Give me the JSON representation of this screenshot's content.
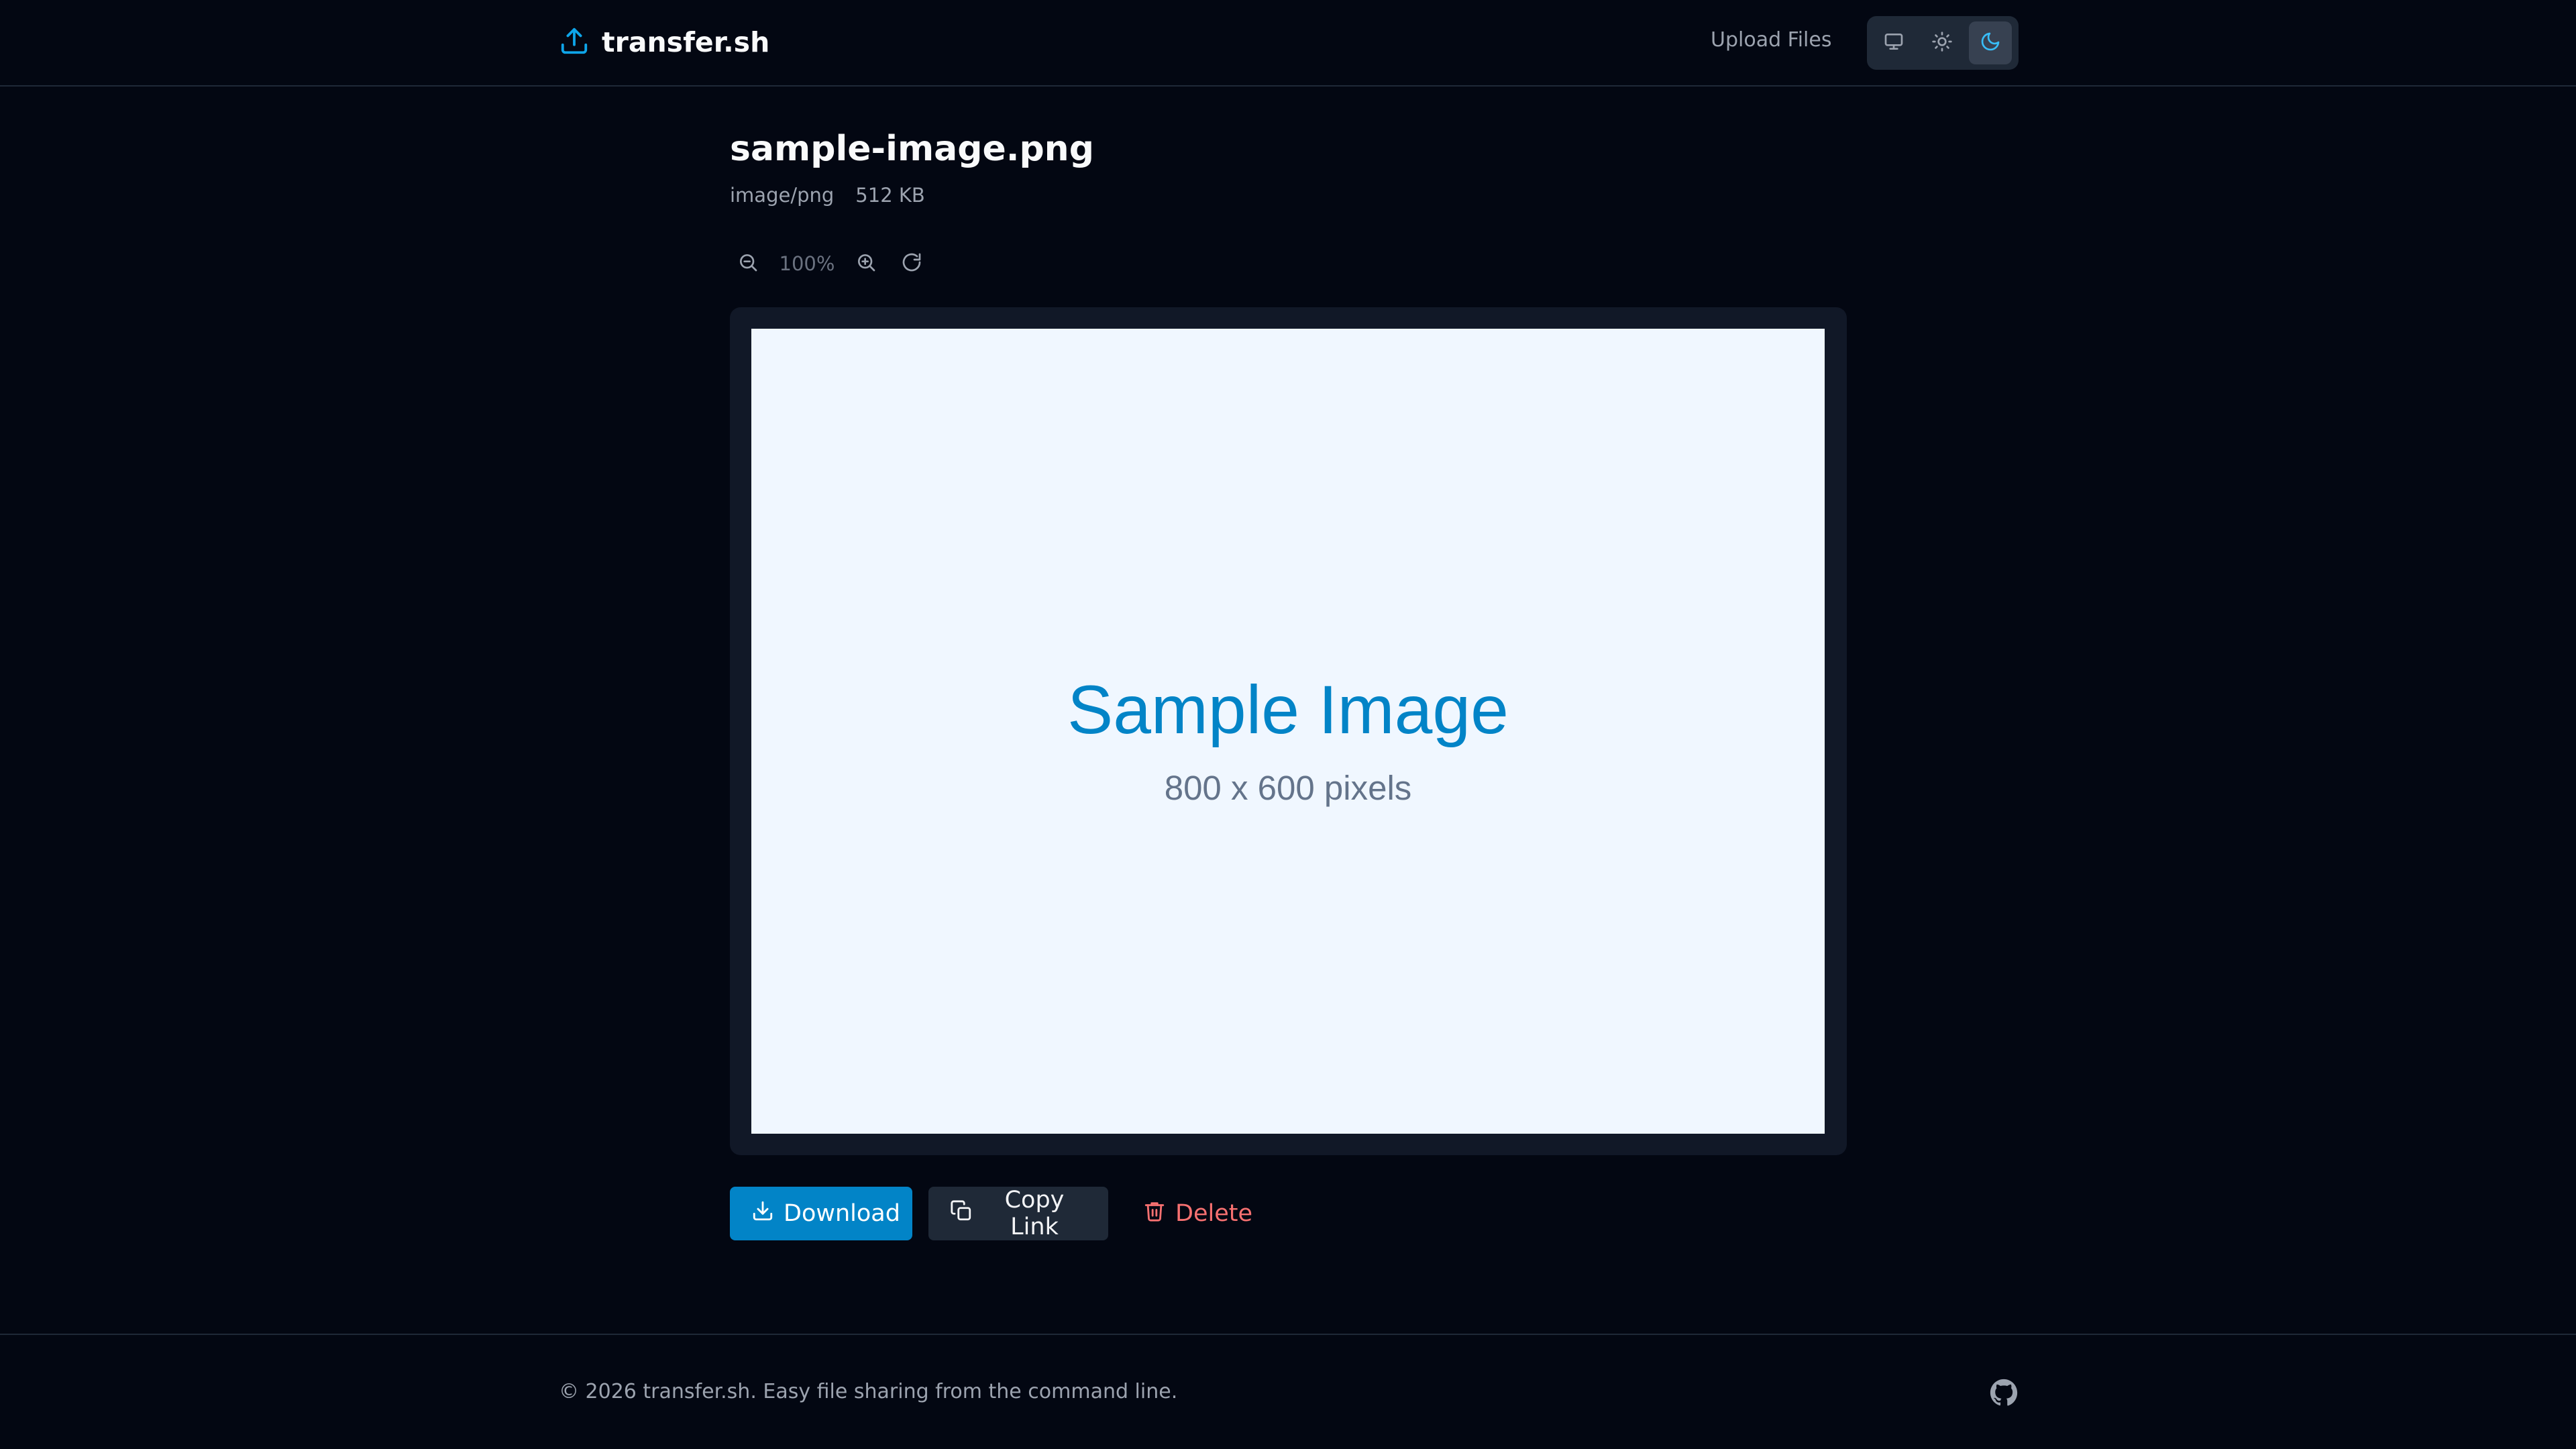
{
  "header": {
    "brand": "transfer.sh",
    "brand_icon": "upload-icon",
    "nav_upload": "Upload Files",
    "theme_options": [
      "monitor-icon",
      "sun-icon",
      "moon-icon"
    ],
    "active_theme": "moon-icon"
  },
  "file": {
    "name": "sample-image.png",
    "type": "image/png",
    "size": "512 KB"
  },
  "zoom": {
    "level": "100%",
    "zoom_out_icon": "zoom-out-icon",
    "zoom_in_icon": "zoom-in-icon",
    "reset_icon": "rotate-icon"
  },
  "preview": {
    "title": "Sample Image",
    "subtitle": "800 x 600 pixels"
  },
  "actions": {
    "download": "Download",
    "copy_link": "Copy Link",
    "delete": "Delete"
  },
  "footer": {
    "text": "© 2026 transfer.sh. Easy file sharing from the command line.",
    "github_icon": "github-icon"
  },
  "colors": {
    "background": "#030712",
    "accent": "#0284c7",
    "danger": "#f87171",
    "surface": "#1f2937",
    "muted_text": "#9ca3af"
  }
}
